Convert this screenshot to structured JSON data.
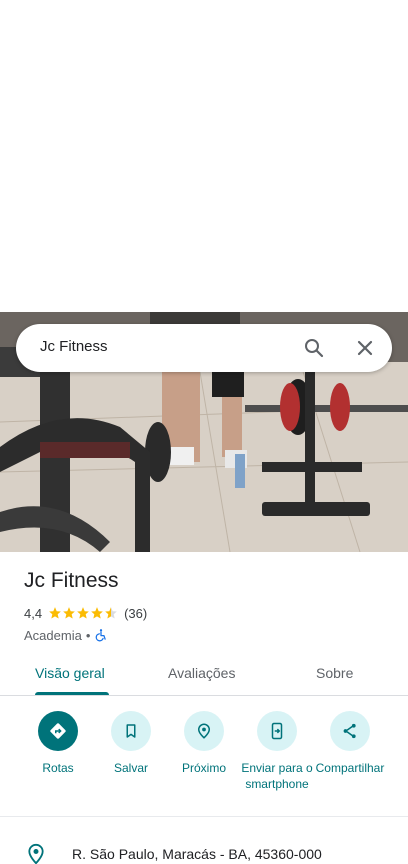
{
  "search": {
    "query": "Jc Fitness"
  },
  "place": {
    "name": "Jc Fitness",
    "rating": "4,4",
    "stars_filled": 4.5,
    "reviews_count": "(36)",
    "category": "Academia",
    "separator": "•"
  },
  "tabs": [
    {
      "label": "Visão geral",
      "active": true
    },
    {
      "label": "Avaliações",
      "active": false
    },
    {
      "label": "Sobre",
      "active": false
    }
  ],
  "actions": [
    {
      "label": "Rotas",
      "icon": "directions-icon"
    },
    {
      "label": "Salvar",
      "icon": "bookmark-icon"
    },
    {
      "label": "Próximo",
      "icon": "nearby-icon"
    },
    {
      "label": "Enviar para o smartphone",
      "icon": "send-to-phone-icon"
    },
    {
      "label": "Compartilhar",
      "icon": "share-icon"
    }
  ],
  "address": {
    "text": "R. São Paulo, Maracás - BA, 45360-000",
    "icon": "location-pin-icon"
  },
  "colors": {
    "accent": "#00737a",
    "accent_light": "#d8f3f5",
    "star": "#fbbc04"
  }
}
